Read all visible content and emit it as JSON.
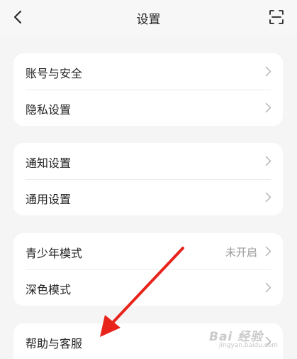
{
  "header": {
    "title": "设置"
  },
  "groups": [
    {
      "rows": [
        {
          "label": "账号与安全",
          "value": ""
        },
        {
          "label": "隐私设置",
          "value": ""
        }
      ]
    },
    {
      "rows": [
        {
          "label": "通知设置",
          "value": ""
        },
        {
          "label": "通用设置",
          "value": ""
        }
      ]
    },
    {
      "rows": [
        {
          "label": "青少年模式",
          "value": "未开启"
        },
        {
          "label": "深色模式",
          "value": ""
        }
      ]
    },
    {
      "rows": [
        {
          "label": "帮助与客服",
          "value": ""
        }
      ]
    }
  ],
  "watermark": {
    "text": "Bai 经验",
    "sub": "jingyan.baidu.com"
  },
  "colors": {
    "background": "#f5f5f5",
    "card": "#ffffff",
    "annotation_arrow": "#e8231c"
  },
  "icons": {
    "back": "chevron-left-icon",
    "scan": "scan-icon",
    "row": "chevron-right-icon"
  }
}
